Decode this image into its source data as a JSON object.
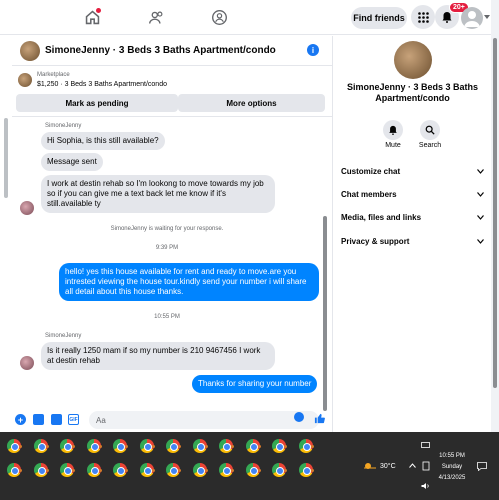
{
  "topbar": {
    "find_friends": "Find friends",
    "notif_badge": "20+"
  },
  "chat": {
    "title": "SimoneJenny · 3 Beds 3 Baths Apartment/condo",
    "marketplace_label": "Marketplace",
    "listing": "$1,250 · 3 Beds 3 Baths Apartment/condo",
    "mark_pending": "Mark as pending",
    "more_options": "More options"
  },
  "messages": {
    "sender1": "SimoneJenny",
    "m1": "Hi Sophia, is this still available?",
    "m2": "Message sent",
    "m3": "I work at destin rehab so I'm lookong to move towards my job so if you can give me a text back let me know if it's still.available ty",
    "waiting": "SimoneJenny is waiting for your response.",
    "time1": "9:39 PM",
    "m4": "hello! yes this house available for rent and ready to move.are you intrested viewing the house tour.kindly send your number i will share all detail about this house thanks.",
    "time2": "10:55 PM",
    "sender2": "SimoneJenny",
    "m5": "Is it really 1250 mam if so my number is 210 9467456 I work at destin rehab",
    "m6": "Thanks for sharing your number"
  },
  "composer": {
    "placeholder": "Aa"
  },
  "side": {
    "title": "SimoneJenny · 3 Beds 3 Baths Apartment/condo",
    "mute": "Mute",
    "search": "Search",
    "rows": [
      "Customize chat",
      "Chat members",
      "Media, files and links",
      "Privacy & support"
    ]
  },
  "taskbar": {
    "temp": "30°C",
    "time": "10:55 PM",
    "day": "Sunday",
    "date": "4/13/2025"
  },
  "colors": {
    "accent": "#0084ff",
    "brand": "#1877f2",
    "badge": "#e41e3f"
  }
}
